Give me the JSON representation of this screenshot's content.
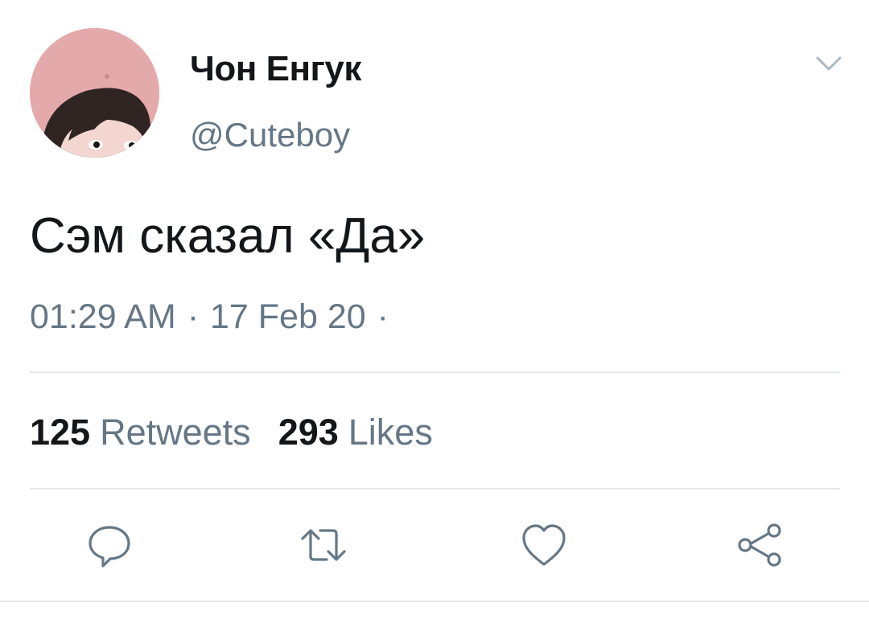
{
  "tweet": {
    "author": {
      "display_name": "Чон Енгук",
      "handle": "@Cuteboy",
      "avatar_icon": "user-avatar-photo"
    },
    "text": "Сэм сказал «Да»",
    "time": "01:29 AM",
    "separator": "·",
    "date": "17 Feb 20",
    "trailing_separator": "·",
    "stats": {
      "retweets_count": "125",
      "retweets_label": "Retweets",
      "likes_count": "293",
      "likes_label": "Likes"
    },
    "actions": [
      {
        "name": "reply",
        "icon": "speech-bubble-icon"
      },
      {
        "name": "retweet",
        "icon": "retweet-arrows-icon"
      },
      {
        "name": "like",
        "icon": "heart-icon"
      },
      {
        "name": "share",
        "icon": "share-nodes-icon"
      }
    ],
    "menu_icon": "chevron-down-icon"
  },
  "colors": {
    "text_primary": "#14171a",
    "text_secondary": "#657786",
    "divider": "#e1e8ed",
    "avatar_background": "#e3a9ab"
  }
}
